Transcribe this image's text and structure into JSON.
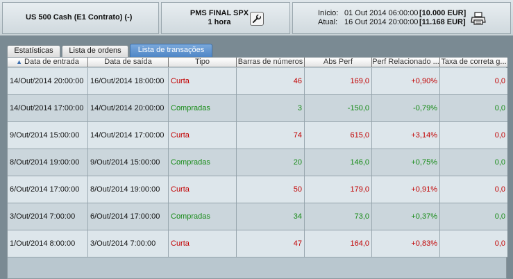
{
  "header": {
    "symbol": "US 500 Cash (E1 Contrato) (-)",
    "strategy_name": "PMS FINAL SPX",
    "timeframe": "1 hora",
    "start_label": "Início:",
    "start_date": "01 Out 2014 06:00:00",
    "start_amount": "[10.000 EUR]",
    "end_label": "Atual:",
    "end_date": "16 Out 2014 20:00:00",
    "end_amount": "[11.168 EUR]"
  },
  "tabs": [
    {
      "label": "Estatísticas",
      "active": false
    },
    {
      "label": "Lista de ordens",
      "active": false
    },
    {
      "label": "Lista de transações",
      "active": true
    }
  ],
  "columns": [
    "Data de entrada",
    "Data de saída",
    "Tipo",
    "Barras de números",
    "Abs Perf",
    "Perf Relacionado ...",
    "Taxa de correta g..."
  ],
  "rows": [
    {
      "entry": "14/Out/2014 20:00:00",
      "exit": "16/Out/2014 18:00:00",
      "type": "Curta",
      "bars": "46",
      "abs_perf": "169,0",
      "rel_perf": "+0,90%",
      "fee": "0,0",
      "color": "red"
    },
    {
      "entry": "14/Out/2014 17:00:00",
      "exit": "14/Out/2014 20:00:00",
      "type": "Compradas",
      "bars": "3",
      "abs_perf": "-150,0",
      "rel_perf": "-0,79%",
      "fee": "0,0",
      "color": "green"
    },
    {
      "entry": "9/Out/2014 15:00:00",
      "exit": "14/Out/2014 17:00:00",
      "type": "Curta",
      "bars": "74",
      "abs_perf": "615,0",
      "rel_perf": "+3,14%",
      "fee": "0,0",
      "color": "red"
    },
    {
      "entry": "8/Out/2014 19:00:00",
      "exit": "9/Out/2014 15:00:00",
      "type": "Compradas",
      "bars": "20",
      "abs_perf": "146,0",
      "rel_perf": "+0,75%",
      "fee": "0,0",
      "color": "green"
    },
    {
      "entry": "6/Out/2014 17:00:00",
      "exit": "8/Out/2014 19:00:00",
      "type": "Curta",
      "bars": "50",
      "abs_perf": "179,0",
      "rel_perf": "+0,91%",
      "fee": "0,0",
      "color": "red"
    },
    {
      "entry": "3/Out/2014 7:00:00",
      "exit": "6/Out/2014 17:00:00",
      "type": "Compradas",
      "bars": "34",
      "abs_perf": "73,0",
      "rel_perf": "+0,37%",
      "fee": "0,0",
      "color": "green"
    },
    {
      "entry": "1/Out/2014 8:00:00",
      "exit": "3/Out/2014 7:00:00",
      "type": "Curta",
      "bars": "47",
      "abs_perf": "164,0",
      "rel_perf": "+0,83%",
      "fee": "0,0",
      "color": "red"
    }
  ],
  "icons": {
    "settings": "wrench-icon",
    "print": "printer-icon",
    "sort": "sort-ascending-icon"
  },
  "colors": {
    "short": "#c20000",
    "long": "#158a15",
    "active_tab": "#4f86c6"
  }
}
